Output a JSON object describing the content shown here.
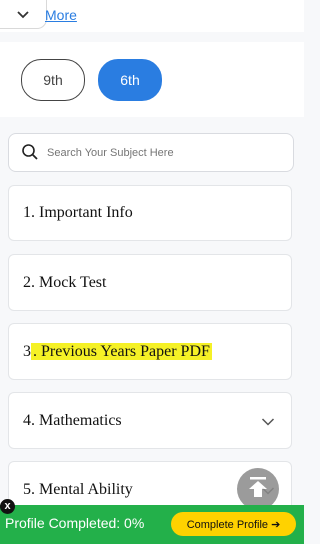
{
  "top": {
    "more_label": "More",
    "collapse_icon": "chevron-down-icon"
  },
  "classes": {
    "items": [
      {
        "label": "9th",
        "selected": false
      },
      {
        "label": "6th",
        "selected": true
      }
    ]
  },
  "search": {
    "placeholder": "Search Your Subject Here",
    "icon": "search-icon"
  },
  "subjects": [
    {
      "label": "1. Important Info",
      "expandable": false
    },
    {
      "label": "2. Mock Test",
      "expandable": false
    },
    {
      "label_prefix": "3",
      "label_highlight": ". Previous Years Paper PDF",
      "highlight_color": "#f5f126",
      "expandable": false
    },
    {
      "label": "4. Mathematics",
      "expandable": true
    },
    {
      "label": "5. Mental Ability",
      "expandable": true
    }
  ],
  "profile": {
    "status_text": "Profile Completed: 0%",
    "button_label": "Complete Profile ➔",
    "close_label": "x",
    "bar_color": "#23b04a",
    "button_color": "#ffd200"
  },
  "colors": {
    "accent": "#2a7de1"
  }
}
